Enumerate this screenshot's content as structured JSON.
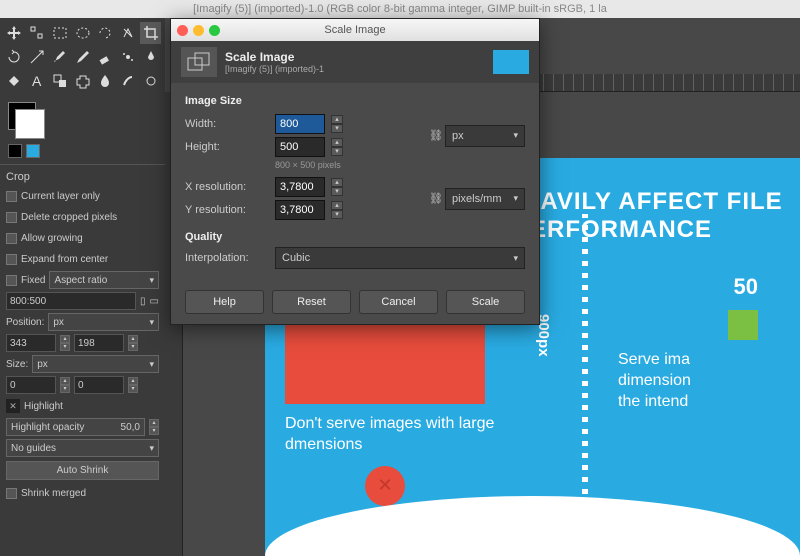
{
  "menubar": {
    "title": "[Imagify (5)] (imported)-1.0 (RGB color 8-bit gamma integer, GIMP built-in sRGB, 1 la"
  },
  "toolbox": {
    "rows": [
      [
        "move",
        "align",
        "rect-select",
        "ellipse-select",
        "free-select",
        "fuzzy-select",
        "crop"
      ],
      [
        "rotate",
        "scale",
        "paintbrush",
        "pencil",
        "eraser",
        "airbrush",
        "ink"
      ],
      [
        "bucket",
        "text",
        "clone",
        "heal",
        "blur",
        "smudge",
        "dodge"
      ]
    ]
  },
  "crop": {
    "title": "Crop",
    "current_layer": "Current layer only",
    "delete_cropped": "Delete cropped pixels",
    "allow_growing": "Allow growing",
    "expand_center": "Expand from center",
    "fixed": "Fixed",
    "aspect": "Aspect ratio",
    "ratio": "800:500",
    "position": "Position:",
    "pos_x": "343",
    "pos_y": "198",
    "pos_unit": "px",
    "size": "Size:",
    "size_w": "0",
    "size_h": "0",
    "size_unit": "px",
    "highlight": "Highlight",
    "highlight_opacity": "Highlight opacity",
    "highlight_val": "50,0",
    "no_guides": "No guides",
    "auto_shrink": "Auto Shrink",
    "shrink_merged": "Shrink merged"
  },
  "dialog": {
    "window_title": "Scale Image",
    "header_title": "Scale Image",
    "header_sub": "[Imagify (5)] (imported)-1",
    "image_size": "Image Size",
    "width_lbl": "Width:",
    "width_val": "800",
    "height_lbl": "Height:",
    "height_val": "500",
    "hint": "800 × 500 pixels",
    "px_unit": "px",
    "xres_lbl": "X resolution:",
    "xres_val": "3,7800",
    "yres_lbl": "Y resolution:",
    "yres_val": "3,7800",
    "res_unit": "pixels/mm",
    "quality": "Quality",
    "interp_lbl": "Interpolation:",
    "interp_val": "Cubic",
    "help": "Help",
    "reset": "Reset",
    "cancel": "Cancel",
    "scale": "Scale"
  },
  "poster": {
    "headline1": "ONS HEAVILY AFFECT FILE",
    "headline2": "PERFORMANCE",
    "dim_label": "900px",
    "caption1": "Don't serve images with large dmensions",
    "five": "50",
    "caption2a": "Serve ima",
    "caption2b": "dimension",
    "caption2c": "the intend"
  }
}
